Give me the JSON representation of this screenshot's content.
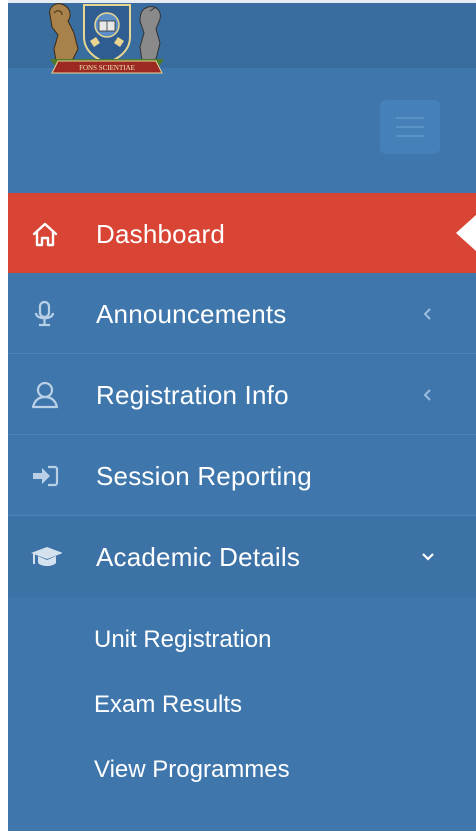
{
  "header": {
    "logo_motto": "FONS SCIENTIAE",
    "menu_toggle_icon": "hamburger-icon"
  },
  "menu": {
    "items": [
      {
        "label": "Dashboard",
        "icon": "home-icon",
        "active": true
      },
      {
        "label": "Announcements",
        "icon": "microphone-icon",
        "chevron": "chevron-left-icon"
      },
      {
        "label": "Registration Info",
        "icon": "user-icon",
        "chevron": "chevron-left-icon"
      },
      {
        "label": "Session Reporting",
        "icon": "sign-in-icon"
      },
      {
        "label": "Academic Details",
        "icon": "graduation-cap-icon",
        "chevron": "chevron-down-icon",
        "expanded": true
      }
    ],
    "submenu": [
      {
        "label": "Unit Registration"
      },
      {
        "label": "Exam Results"
      },
      {
        "label": "View Programmes"
      }
    ]
  },
  "colors": {
    "sidebar_bg": "#3f77ad",
    "header_bg": "#3a6d9f",
    "active_bg": "#d94534",
    "text": "#ffffff",
    "icon_muted": "#b9d0e6"
  }
}
